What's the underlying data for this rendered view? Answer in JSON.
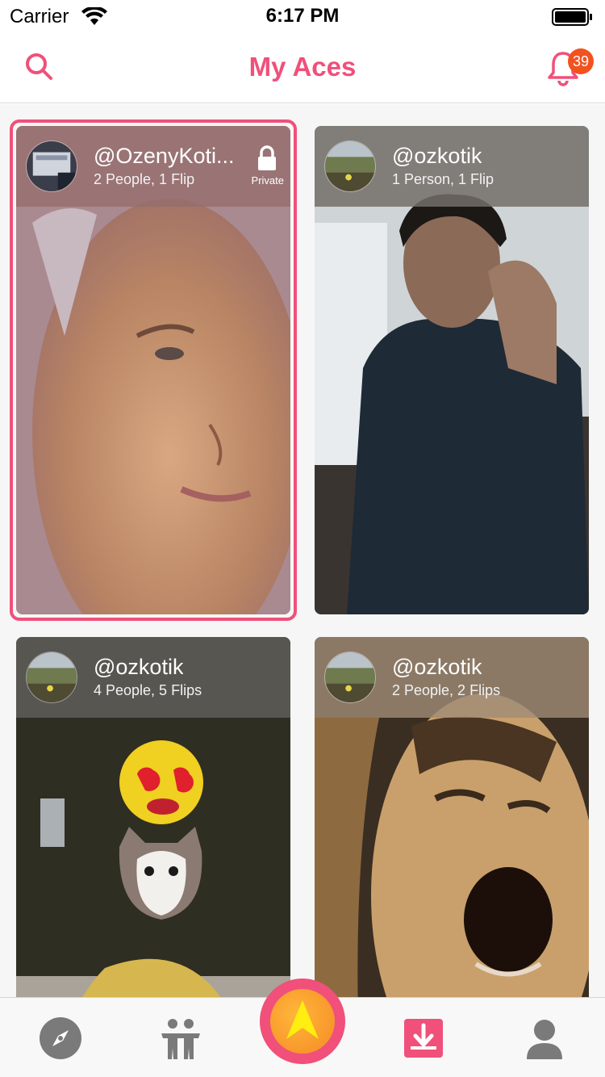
{
  "status_bar": {
    "carrier": "Carrier",
    "time": "6:17 PM"
  },
  "nav": {
    "title": "My Aces",
    "notification_count": "39"
  },
  "cards": [
    {
      "username": "@OzenyKoti...",
      "stats": "2 People, 1 Flip",
      "private_label": "Private",
      "selected": true,
      "is_private": true
    },
    {
      "username": "@ozkotik",
      "stats": "1 Person, 1 Flip",
      "selected": false,
      "is_private": false
    },
    {
      "username": "@ozkotik",
      "stats": "4 People, 5 Flips",
      "selected": false,
      "is_private": false
    },
    {
      "username": "@ozkotik",
      "stats": "2 People, 2 Flips",
      "selected": false,
      "is_private": false
    }
  ],
  "tabbar": {
    "items": [
      {
        "icon": "compass-icon"
      },
      {
        "icon": "people-icon"
      },
      {
        "icon": "create-arrow-icon"
      },
      {
        "icon": "inbox-download-icon",
        "active": true
      },
      {
        "icon": "profile-icon"
      }
    ]
  },
  "colors": {
    "accent": "#f0507a",
    "badge": "#f2521f",
    "create": "#f58a25"
  }
}
